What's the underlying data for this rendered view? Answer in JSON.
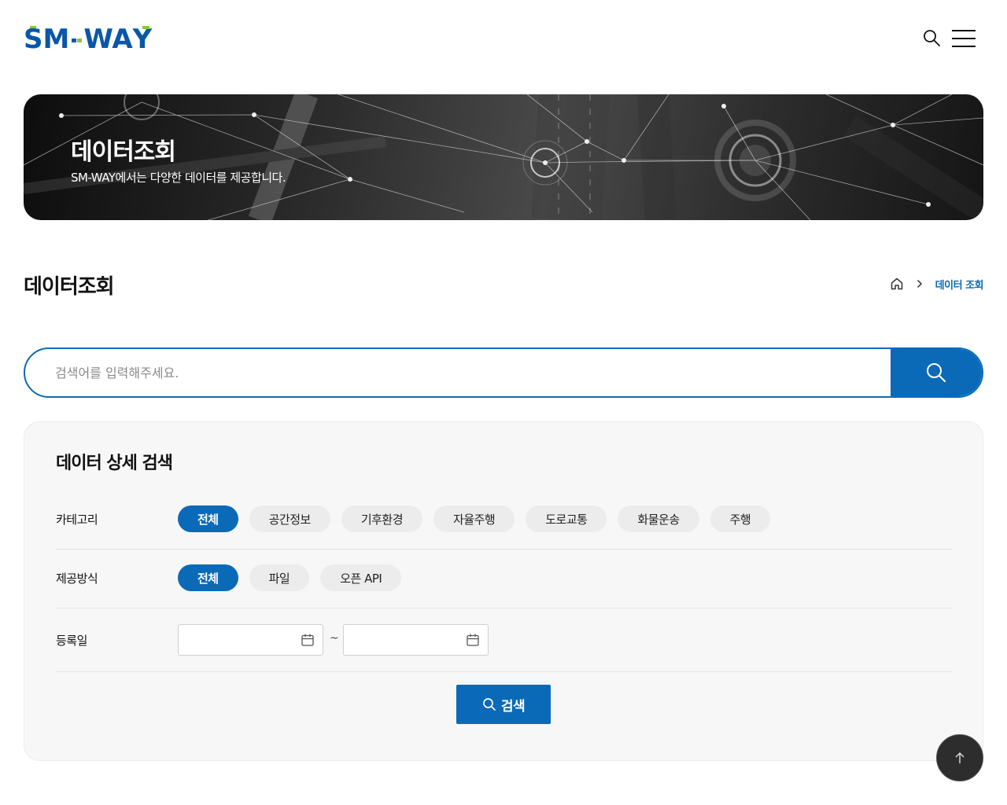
{
  "header": {
    "logo_text": "SM-WAY",
    "brand_colors": {
      "primary": "#0a57a8",
      "accent": "#8cc63f"
    },
    "search_icon": "search-icon",
    "menu_icon": "hamburger-menu-icon"
  },
  "banner": {
    "title": "데이터조회",
    "subtitle": "SM-WAY에서는 다양한 데이터를 제공합니다."
  },
  "page": {
    "title": "데이터조회",
    "breadcrumb": {
      "home_icon": "home-icon",
      "separator_icon": "chevron-right-icon",
      "current": "데이터 조회"
    }
  },
  "search": {
    "placeholder": "검색어를 입력해주세요.",
    "value": "",
    "button_icon": "search-icon"
  },
  "detail_search": {
    "title": "데이터 상세 검색",
    "category": {
      "label": "카테고리",
      "options": [
        "전체",
        "공간정보",
        "기후환경",
        "자율주행",
        "도로교통",
        "화물운송",
        "주행"
      ],
      "selected": "전체"
    },
    "provision": {
      "label": "제공방식",
      "options": [
        "전체",
        "파일",
        "오픈 API"
      ],
      "selected": "전체"
    },
    "registration_date": {
      "label": "등록일",
      "start_value": "",
      "end_value": "",
      "separator": "~",
      "icon": "calendar-icon"
    },
    "submit_label": "검색"
  },
  "scroll_top_icon": "arrow-up-icon",
  "colors": {
    "accent": "#0a6ab8",
    "panel_bg": "#f7f7f7",
    "chip_bg": "#ececec"
  }
}
